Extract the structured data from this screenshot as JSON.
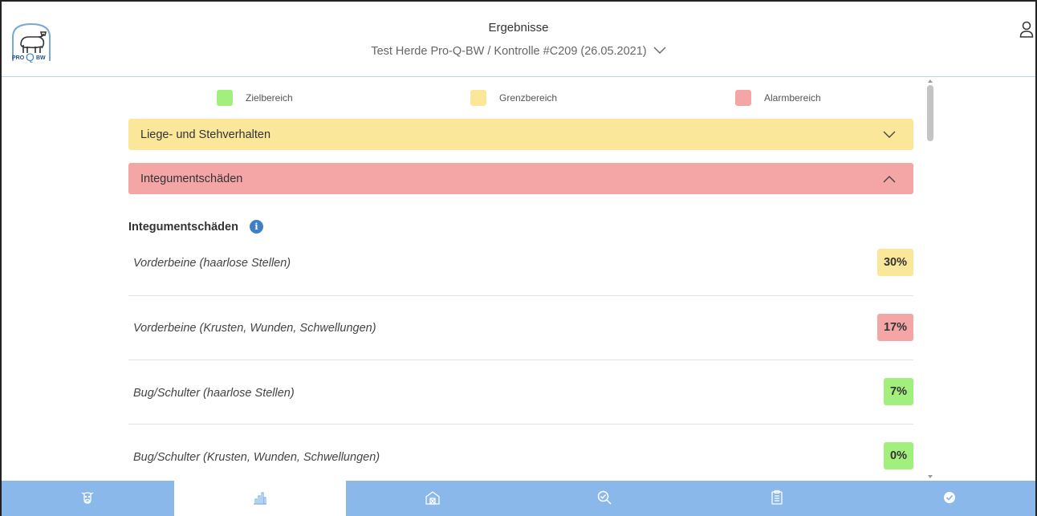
{
  "header": {
    "title": "Ergebnisse",
    "subtitle": "Test Herde Pro-Q-BW / Kontrolle #C209 (26.05.2021)",
    "logo_text": "PRO Q BW"
  },
  "legend": [
    {
      "label": "Zielbereich",
      "color": "#a3ef7d"
    },
    {
      "label": "Grenzbereich",
      "color": "#fbe79a"
    },
    {
      "label": "Alarmbereich",
      "color": "#f4a6a6"
    }
  ],
  "sections": [
    {
      "label": "Liege- und Stehverhalten",
      "status": "Grenzbereich",
      "expanded": false
    },
    {
      "label": "Integumentschäden",
      "status": "Alarmbereich",
      "expanded": true
    }
  ],
  "detail": {
    "heading": "Integumentschäden",
    "rows": [
      {
        "label": "Vorderbeine (haarlose Stellen)",
        "value": "30%",
        "color": "#fbe79a"
      },
      {
        "label": "Vorderbeine (Krusten, Wunden, Schwellungen)",
        "value": "17%",
        "color": "#f4a6a6"
      },
      {
        "label": "Bug/Schulter (haarlose Stellen)",
        "value": "7%",
        "color": "#a3ef7d"
      },
      {
        "label": "Bug/Schulter (Krusten, Wunden, Schwellungen)",
        "value": "0%",
        "color": "#a3ef7d"
      }
    ]
  },
  "nav": [
    {
      "icon": "cow-icon",
      "active": false
    },
    {
      "icon": "bar-chart-icon",
      "active": true
    },
    {
      "icon": "barn-icon",
      "active": false
    },
    {
      "icon": "search-check-icon",
      "active": false
    },
    {
      "icon": "clipboard-icon",
      "active": false
    },
    {
      "icon": "check-circle-icon",
      "active": false
    }
  ],
  "colors": {
    "accent": "#8ab8ea",
    "icon": "#ffffff",
    "active_icon": "#8ab8ea"
  }
}
